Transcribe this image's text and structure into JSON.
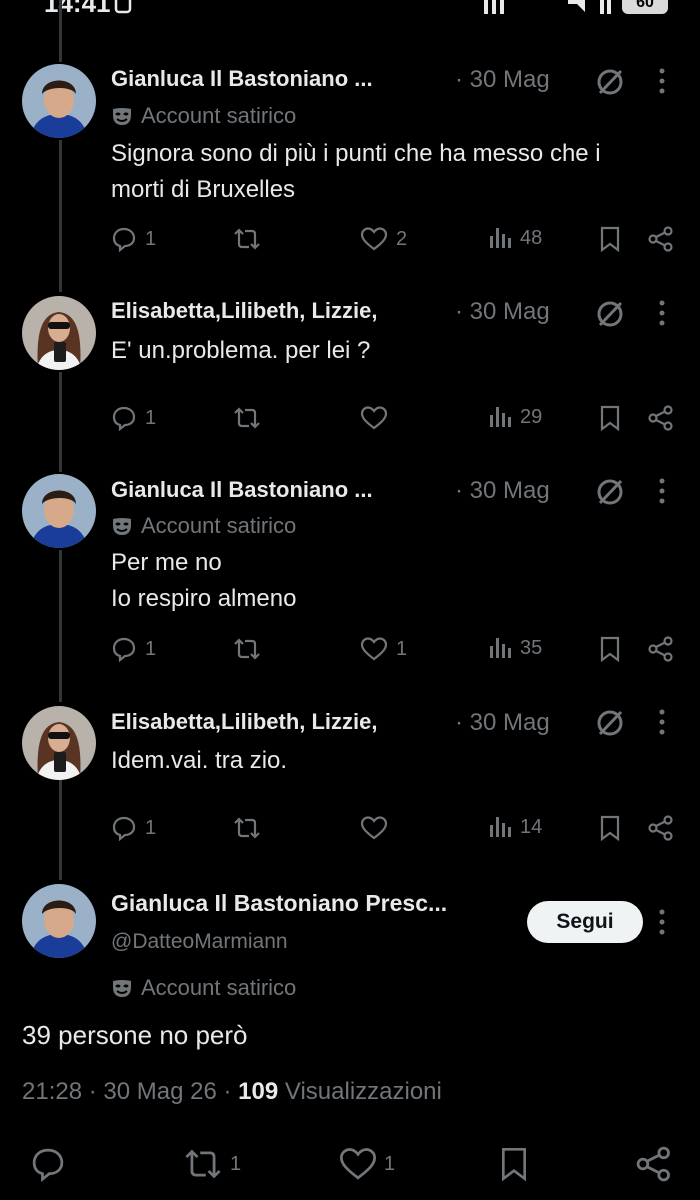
{
  "status_bar": {
    "time": "14:41",
    "battery": "60"
  },
  "replies": [
    {
      "name": "Gianluca Il Bastoniano ...",
      "date": "· 30 Mag",
      "badge": "Account satirico",
      "lines": [
        "Signora sono di più i punti che ha messo che i",
        "morti di Bruxelles"
      ],
      "replies": "1",
      "reposts": "",
      "likes": "2",
      "views": "48"
    },
    {
      "name": "Elisabetta,Lilibeth, Lizzie,",
      "date": "· 30 Mag",
      "badge": "",
      "lines": [
        "E' un.problema. per lei ?"
      ],
      "replies": "1",
      "reposts": "",
      "likes": "",
      "views": "29"
    },
    {
      "name": "Gianluca Il Bastoniano ...",
      "date": "· 30 Mag",
      "badge": "Account satirico",
      "lines": [
        "Per me no",
        "Io respiro almeno"
      ],
      "replies": "1",
      "reposts": "",
      "likes": "1",
      "views": "35"
    },
    {
      "name": "Elisabetta,Lilibeth, Lizzie,",
      "date": "· 30 Mag",
      "badge": "",
      "lines": [
        "Idem.vai. tra zio."
      ],
      "replies": "1",
      "reposts": "",
      "likes": "",
      "views": "14"
    }
  ],
  "main_post": {
    "name": "Gianluca Il Bastoniano Presc...",
    "handle": "@DatteoMarmiann",
    "badge": "Account satirico",
    "follow_label": "Segui",
    "text": "39 persone no però",
    "time": "21:28",
    "date": "30 Mag 26",
    "views_count": "109",
    "views_label": "Visualizzazioni",
    "reposts": "1",
    "likes": "1"
  },
  "colors": {
    "background": "#000000",
    "text": "#e7e9ea",
    "muted": "#71767b",
    "follow_bg": "#eff3f4"
  },
  "icons": [
    "reply-icon",
    "repost-icon",
    "like-icon",
    "views-icon",
    "bookmark-icon",
    "share-icon",
    "mute-icon",
    "more-icon",
    "satire-mask-icon"
  ]
}
